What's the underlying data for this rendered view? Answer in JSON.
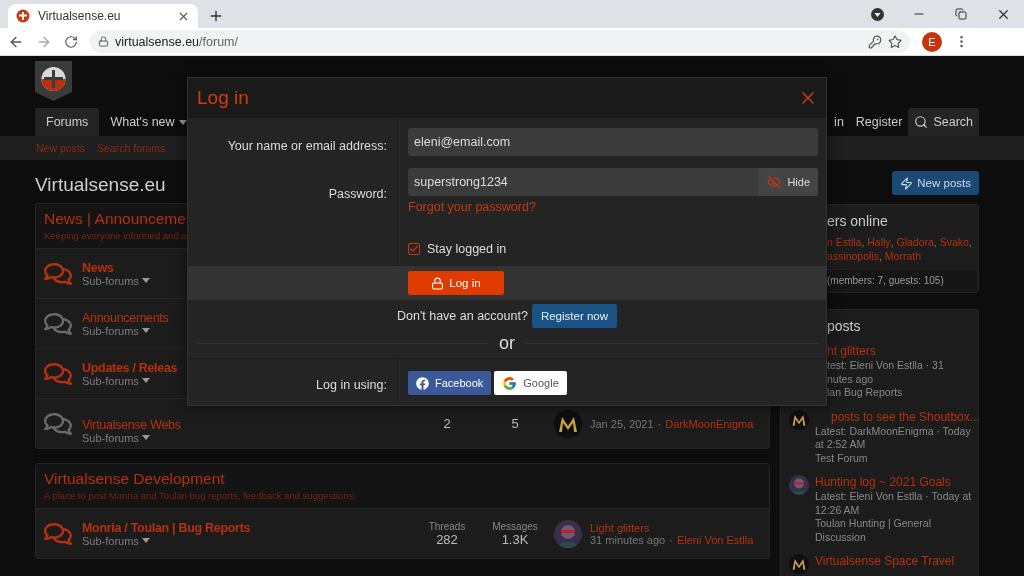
{
  "browser": {
    "tab_title": "Virtualsense.eu",
    "url_host": "virtualsense.eu",
    "url_path": "/forum/",
    "profile_initial": "E"
  },
  "header": {
    "nav": [
      {
        "label": "Forums",
        "selected": true,
        "dropdown": false
      },
      {
        "label": "What's new",
        "selected": false,
        "dropdown": true
      }
    ],
    "account_nav": [
      {
        "kind": "link",
        "label": "in"
      },
      {
        "kind": "link",
        "label": "Register"
      },
      {
        "kind": "search",
        "label": "Search"
      }
    ],
    "subnav": [
      "New posts",
      "Search forums"
    ]
  },
  "page_title": "Virtualsense.eu",
  "new_posts_button": "New posts",
  "categories": [
    {
      "title": "News | Announceme",
      "description": "Keeping everyone informed and a",
      "nodes": [
        {
          "title": "News",
          "unread": true,
          "subforums": "Sub-forums"
        },
        {
          "title": "Announcements",
          "unread": false,
          "subforums": "Sub-forums"
        },
        {
          "title": "Updates / Releas",
          "unread": true,
          "subforums": "Sub-forums"
        },
        {
          "title": "Virtualsense Webs",
          "unread": false,
          "subforums": "Sub-forums",
          "threads": "2",
          "messages": "5",
          "last_post": {
            "date": "Jan 25, 2021",
            "separator": "·",
            "user": "DarkMoonEnigma"
          }
        }
      ]
    },
    {
      "title": "Virtualsense Development",
      "description": "A place to post Monria and Toulan bug reports, feedback and suggestions.",
      "nodes": [
        {
          "title": "Monria / Toulan | Bug Reports",
          "unread": true,
          "subforums": "Sub-forums",
          "threads_label": "Threads",
          "threads": "282",
          "messages_label": "Messages",
          "messages": "1.3K",
          "last_post": {
            "title": "Light glitters",
            "date": "31 minutes ago",
            "separator": "·",
            "user": "Eleni Von Estlla"
          }
        }
      ]
    }
  ],
  "members_online": {
    "title": "ers online",
    "lines": [
      [
        {
          "name": "n Estlla",
          "after": ","
        },
        {
          "name": "Hally",
          "after": ","
        },
        {
          "name": "Gladora",
          "after": ","
        },
        {
          "name": "Svako",
          "after": ","
        }
      ],
      [
        {
          "name": "assinopolis",
          "after": ","
        },
        {
          "name": "Morrath"
        }
      ]
    ],
    "footer": "(members: 7, guests: 105)"
  },
  "latest_posts": {
    "title": "posts",
    "items": [
      {
        "title": "ht glitters",
        "lines": [
          "test: Eleni Von Estlla · 31",
          "nutes ago",
          "lan Bug Reports"
        ]
      },
      {
        "title": "posts to see the Shoutbox...",
        "lines": [
          "Latest: DarkMoonEnigma · Today",
          "at 2:52 AM",
          "Test Forum"
        ]
      },
      {
        "title": "Hunting log ~ 2021 Goals",
        "lines": [
          "Latest: Eleni Von Estlla · Today at",
          "12:26 AM",
          "Toulan Hunting | General",
          "Discussion"
        ]
      },
      {
        "title": "Virtualsense Space Travel"
      }
    ]
  },
  "modal": {
    "title": "Log in",
    "fields": [
      {
        "kind": "text",
        "label": "Your name or email address:",
        "value": "eleni@email.com"
      },
      {
        "kind": "password",
        "label": "Password:",
        "value": "superstrong1234",
        "toggle": "Hide"
      }
    ],
    "forgot_link": "Forgot your password?",
    "stay_logged_in": {
      "label": "Stay logged in",
      "checked": true
    },
    "submit": "Log in",
    "register_prompt": "Don't have an account?",
    "register_button": "Register now",
    "or": "or",
    "social_label": "Log in using:",
    "social": [
      {
        "kind": "facebook",
        "label": "Facebook"
      },
      {
        "kind": "google",
        "label": "Google"
      }
    ]
  }
}
